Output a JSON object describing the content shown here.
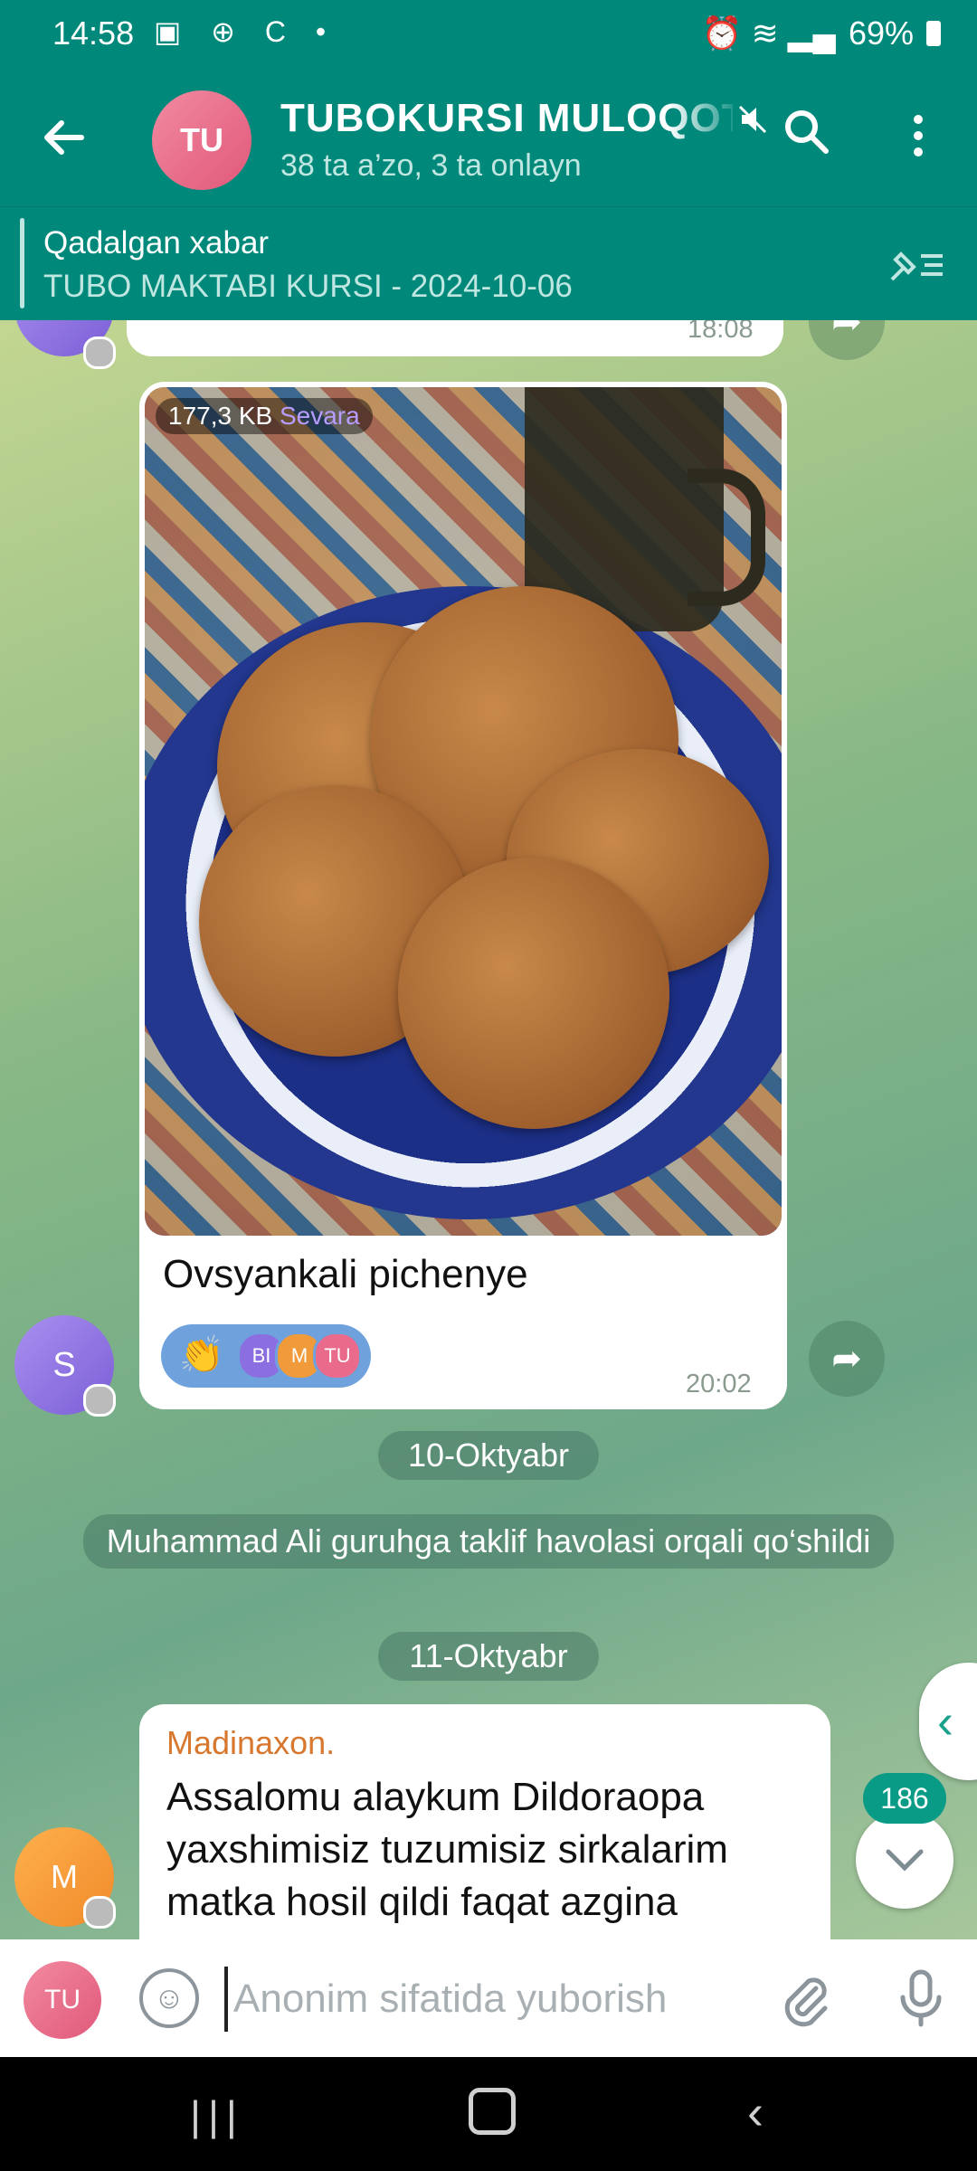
{
  "status_bar": {
    "time": "14:58",
    "icons_left": "▣ ⊕ C •",
    "icons_right": "⏰ ≋ ▂▄",
    "battery": "69%"
  },
  "app_bar": {
    "avatar_initials": "TU",
    "title": "TUBOKURSI MULOQOT",
    "subtitle": "38 ta a’zo, 3 ta onlayn"
  },
  "pinned": {
    "title": "Qadalgan xabar",
    "text": "TUBO MAKTABI KURSI - 2024-10-06"
  },
  "messages": {
    "top_bubble_time": "18:08",
    "top_avatar_initial": "S",
    "photo_size": "177,3 KB",
    "photo_sender": "Sevara",
    "caption": "Ovsyankali pichenye",
    "caption_time": "20:02",
    "sender_avatar_initial": "S",
    "reaction_emoji": "👏",
    "reaction_avatars": [
      "BI",
      "M",
      "TU"
    ]
  },
  "service": {
    "date1": "10-Oktyabr",
    "join_message": "Muhammad Ali guruhga taklif havolasi orqali qo‘shildi",
    "date2": "11-Oktyabr"
  },
  "madinaxon": {
    "name": "Madinaxon.",
    "text": "Assalomu alaykum Dildoraopa yaxshimisiz tuzumisiz sirkalarim matka hosil qildi faqat azgina",
    "avatar_initial": "M"
  },
  "scroll": {
    "unread_count": "186"
  },
  "composer": {
    "avatar_initials": "TU",
    "placeholder": "Anonim sifatida yuborish"
  }
}
